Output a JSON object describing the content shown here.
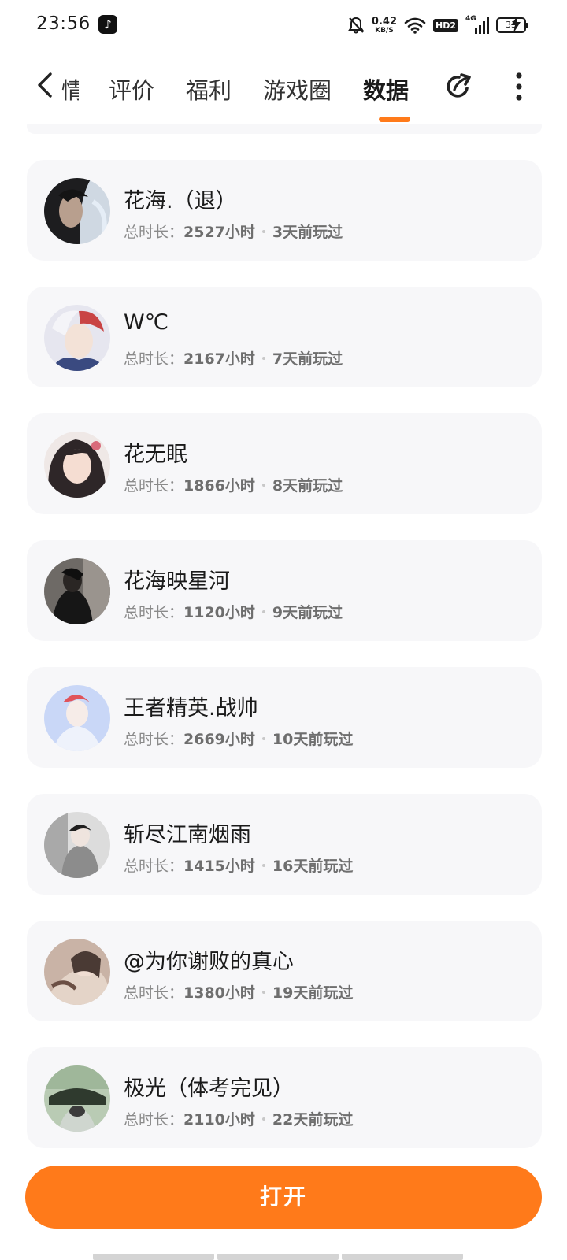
{
  "status_bar": {
    "time": "23:56",
    "app_icon": "tiktok-icon",
    "net_speed_value": "0.42",
    "net_speed_unit": "KB/S",
    "hd_label": "HD2",
    "signal_label": "4G",
    "battery": "33"
  },
  "nav": {
    "back_icon": "chevron-left-icon",
    "tabs": [
      {
        "label": "情",
        "active": false
      },
      {
        "label": "评价",
        "active": false
      },
      {
        "label": "福利",
        "active": false
      },
      {
        "label": "游戏圈",
        "active": false
      },
      {
        "label": "数据",
        "active": true
      }
    ],
    "share_icon": "share-icon",
    "more_icon": "more-vertical-icon",
    "accent_color": "#ff7a1a"
  },
  "players": [
    {
      "name": "花海.（退）",
      "duration_label": "总时长：",
      "hours": "2527小时",
      "last_played": "3天前玩过"
    },
    {
      "name": "W℃",
      "duration_label": "总时长：",
      "hours": "2167小时",
      "last_played": "7天前玩过"
    },
    {
      "name": "花无眠",
      "duration_label": "总时长：",
      "hours": "1866小时",
      "last_played": "8天前玩过"
    },
    {
      "name": "花海映星河",
      "duration_label": "总时长：",
      "hours": "1120小时",
      "last_played": "9天前玩过"
    },
    {
      "name": "王者精英.战帅",
      "duration_label": "总时长：",
      "hours": "2669小时",
      "last_played": "10天前玩过"
    },
    {
      "name": "斩尽江南烟雨",
      "duration_label": "总时长：",
      "hours": "1415小时",
      "last_played": "16天前玩过"
    },
    {
      "name": "@为你谢败的真心",
      "duration_label": "总时长：",
      "hours": "1380小时",
      "last_played": "19天前玩过"
    },
    {
      "name": "极光（体考完见）",
      "duration_label": "总时长：",
      "hours": "2110小时",
      "last_played": "22天前玩过"
    }
  ],
  "open_button_label": "打开"
}
